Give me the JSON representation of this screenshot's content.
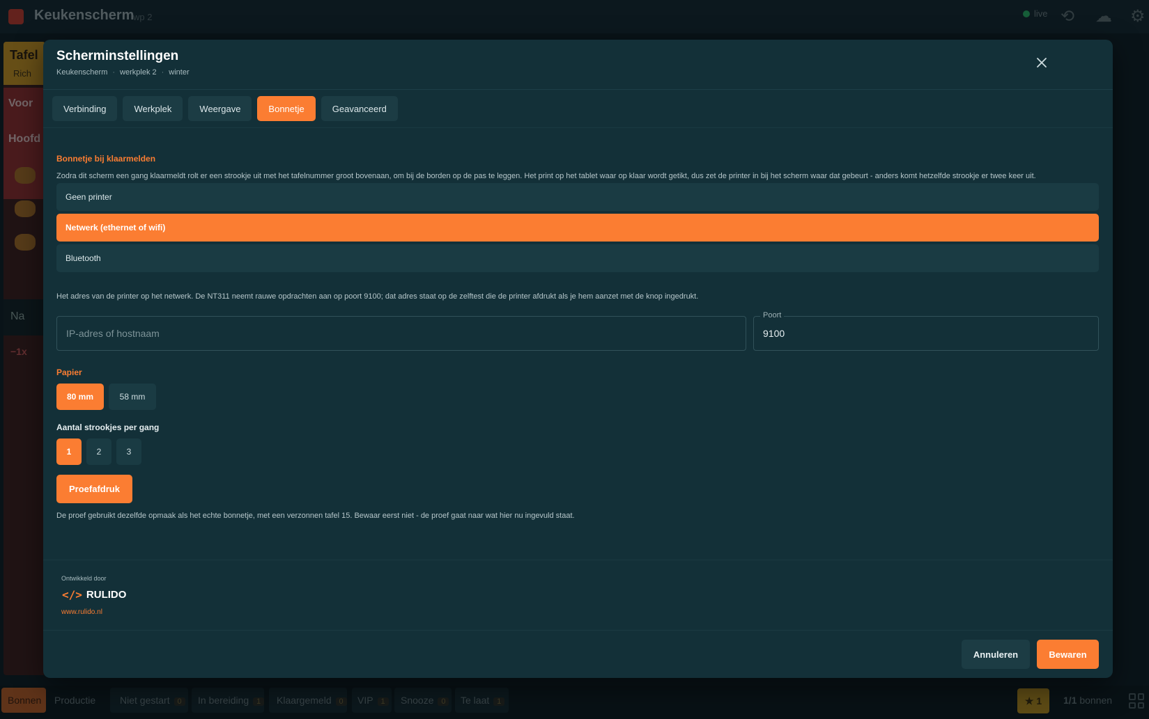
{
  "app": {
    "title": "Keukenscherm",
    "subtitle": "wp 2",
    "status": "live"
  },
  "background_card": {
    "title": "Tafel",
    "meta": "Rich",
    "course_1": "Voor",
    "course_2": "Hoofd",
    "done_label": "Na",
    "qty": "−1x"
  },
  "bottom_bar": {
    "view_bonnen": "Bonnen",
    "view_productie": "Productie",
    "filters": [
      {
        "label": "Niet gestart",
        "count": "0"
      },
      {
        "label": "In bereiding",
        "count": "1"
      },
      {
        "label": "Klaargemeld",
        "count": "0"
      },
      {
        "label": "VIP",
        "count": "1"
      },
      {
        "label": "Snooze",
        "count": "0"
      },
      {
        "label": "Te laat",
        "count": "1"
      }
    ],
    "star_count": "1",
    "ticket_count": "1/1",
    "ticket_suffix": "bonnen"
  },
  "modal": {
    "title": "Scherminstellingen",
    "breadcrumb": [
      "Keukenscherm",
      "werkplek 2",
      "winter"
    ],
    "tabs": [
      "Verbinding",
      "Werkplek",
      "Weergave",
      "Bonnetje",
      "Geavanceerd"
    ],
    "active_tab": "Bonnetje",
    "section_title": "Bonnetje bij klaarmelden",
    "section_desc": "Zodra dit scherm een gang klaarmeldt rolt er een strookje uit met het tafelnummer groot bovenaan, om bij de borden op de pas te leggen. Het print op het tablet waar op klaar wordt getikt, dus zet de printer in bij het scherm waar dat gebeurt - anders komt hetzelfde strookje er twee keer uit.",
    "printer_options": [
      "Geen printer",
      "Netwerk (ethernet of wifi)",
      "Bluetooth"
    ],
    "printer_selected": "Netwerk (ethernet of wifi)",
    "network_desc": "Het adres van de printer op het netwerk. De NT311 neemt rauwe opdrachten aan op poort 9100; dat adres staat op de zelftest die de printer afdrukt als je hem aanzet met de knop ingedrukt.",
    "ip_placeholder": "IP-adres of hostnaam",
    "ip_value": "",
    "port_label": "Poort",
    "port_value": "9100",
    "paper_label": "Papier",
    "paper_options": [
      "80 mm",
      "58 mm"
    ],
    "paper_selected": "80 mm",
    "copies_label": "Aantal strookjes per gang",
    "copies_options": [
      "1",
      "2",
      "3"
    ],
    "copies_selected": "1",
    "proof_button": "Proefafdruk",
    "proof_desc": "De proef gebruikt dezelfde opmaak als het echte bonnetje, met een verzonnen tafel 15. Bewaar eerst niet - de proef gaat naar wat hier nu ingevuld staat.",
    "developer_label": "Ontwikkeld door",
    "developer_name": "RULIDO",
    "developer_url": "www.rulido.nl",
    "cancel_button": "Annuleren",
    "save_button": "Bewaren"
  },
  "colors": {
    "accent": "#fb7d32",
    "modal_bg": "#133038",
    "chip_bg": "#1c3c44"
  },
  "icons": [
    "app-logo-icon",
    "history-icon",
    "cloud-icon",
    "gear-icon",
    "close-icon",
    "code-brackets-icon",
    "star-icon",
    "grid-icon"
  ]
}
